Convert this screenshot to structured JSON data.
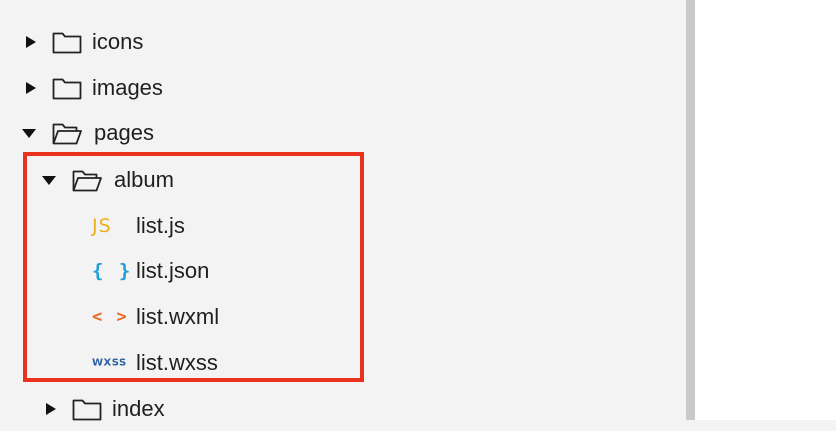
{
  "tree": {
    "items": [
      {
        "label": "icons",
        "type": "folder",
        "expanded": false,
        "depth": 0
      },
      {
        "label": "images",
        "type": "folder",
        "expanded": false,
        "depth": 0
      },
      {
        "label": "pages",
        "type": "folder",
        "expanded": true,
        "depth": 0
      },
      {
        "label": "album",
        "type": "folder",
        "expanded": true,
        "depth": 1
      },
      {
        "label": "list.js",
        "type": "file",
        "icon": "js-icon",
        "icon_text": "JS",
        "depth": 2
      },
      {
        "label": "list.json",
        "type": "file",
        "icon": "json-icon",
        "icon_text": "{ }",
        "depth": 2
      },
      {
        "label": "list.wxml",
        "type": "file",
        "icon": "wxml-icon",
        "icon_text": "< >",
        "depth": 2
      },
      {
        "label": "list.wxss",
        "type": "file",
        "icon": "wxss-icon",
        "icon_text": "WXSS",
        "depth": 2
      },
      {
        "label": "index",
        "type": "folder",
        "expanded": false,
        "depth": 1
      }
    ]
  },
  "colors": {
    "highlight_border": "#e8321e",
    "js_icon": "#f0ad1c",
    "json_icon": "#1e9ed8",
    "wxml_icon": "#e8691e",
    "wxss_icon": "#2a5fa0",
    "panel_background": "#f3f3f3"
  }
}
